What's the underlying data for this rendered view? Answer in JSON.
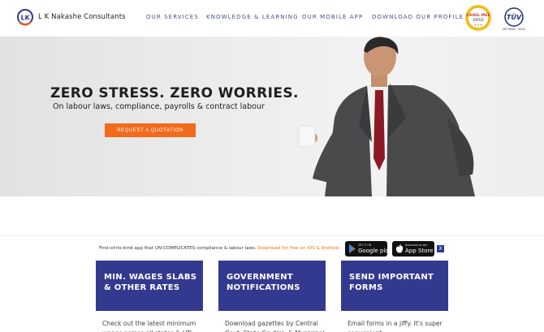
{
  "brand": {
    "name": "L K Nakashe Consultants",
    "mark": "LK",
    "colors": {
      "navy": "#2f3792",
      "orange": "#f26a1b",
      "text": "#4a4f8c"
    }
  },
  "nav": {
    "items": [
      "OUR SERVICES",
      "KNOWLEDGE & LEARNING",
      "OUR MOBILE APP",
      "DOWNLOAD OUR PROFILE"
    ]
  },
  "badges": {
    "crisil": {
      "line1": "CRISIL MSE",
      "line2": "RATED"
    },
    "tuv": {
      "line1": "TÜV",
      "line2": "ISO 9001 : 2015"
    }
  },
  "hero": {
    "title": "ZERO STRESS. ZERO WORRIES.",
    "subtitle": "On labour laws, compliance, payrolls & contract labour",
    "cta_label": "REQUEST A QUOTATION"
  },
  "app_strip": {
    "text": "First-of-its-kind app that UN-COMPLICATES compliance & labour laws. ",
    "link": "Download for free on iOS & Android",
    "google_small": "GET IT ON",
    "google_big": "Google play",
    "apple_small": "Download on the",
    "apple_big": "App Store",
    "close_label": "X"
  },
  "cards": [
    {
      "title": "MIN. WAGES SLABS & OTHER RATES",
      "body": "Check out the latest minimum wages across all states & UTs"
    },
    {
      "title": "GOVERNMENT NOTIFICATIONS",
      "body": "Download gazettes by Central Govt, State Govt(s), & Municipal"
    },
    {
      "title": "SEND IMPORTANT FORMS",
      "body": "Email forms in a jiffy. It's super convenient"
    }
  ]
}
